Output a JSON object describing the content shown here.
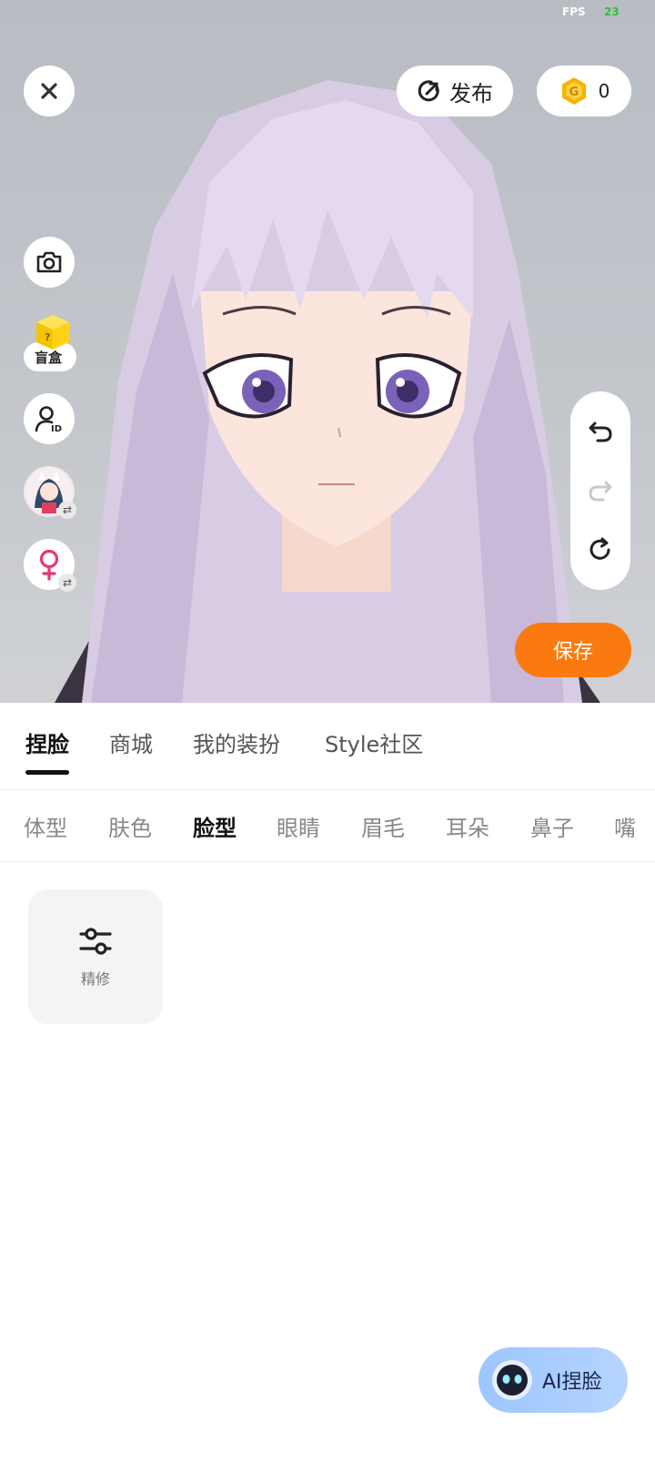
{
  "status": {
    "fps_label": "FPS",
    "fps_value": "23"
  },
  "top_bar": {
    "publish_label": "发布",
    "coins": "0"
  },
  "left_tools": {
    "blind_box_label": "盲盒"
  },
  "save_label": "保存",
  "main_tabs": [
    "捏脸",
    "商城",
    "我的装扮",
    "Style社区"
  ],
  "sub_tabs": [
    "体型",
    "肤色",
    "脸型",
    "眼睛",
    "眉毛",
    "耳朵",
    "鼻子",
    "嘴"
  ],
  "option_tile": {
    "label": "精修"
  },
  "ai_button": {
    "label": "AI捏脸"
  },
  "colors": {
    "accent_orange": "#fb7a10",
    "coin_gold": "#f5b400",
    "female_pink": "#e8357a"
  }
}
